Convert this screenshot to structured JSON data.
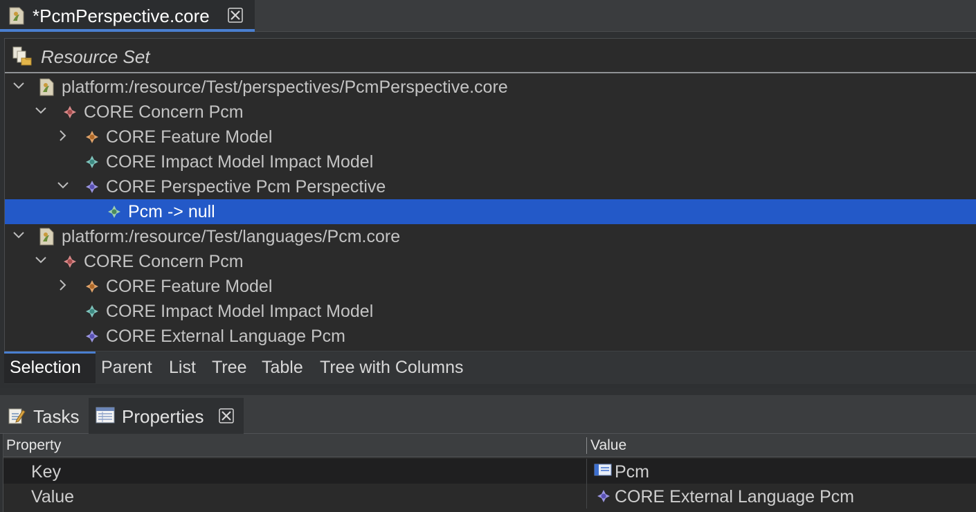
{
  "editor": {
    "tab_title": "*PcmPerspective.core",
    "tab_icon": "core-file-icon",
    "header_label": "Resource Set",
    "header_icon": "resource-set-icon",
    "tree": [
      {
        "label": "platform:/resource/Test/perspectives/PcmPerspective.core",
        "icon": "core-file-icon",
        "expanded": true
      },
      {
        "label": "CORE Concern Pcm",
        "icon": "concern-icon",
        "expanded": true
      },
      {
        "label": "CORE Feature Model",
        "icon": "feature-model-icon",
        "expanded": false
      },
      {
        "label": "CORE Impact Model Impact Model",
        "icon": "impact-model-icon"
      },
      {
        "label": "CORE Perspective Pcm Perspective",
        "icon": "perspective-icon",
        "expanded": true
      },
      {
        "label": "Pcm -> null",
        "icon": "mapping-icon",
        "selected": true
      },
      {
        "label": "platform:/resource/Test/languages/Pcm.core",
        "icon": "core-file-icon",
        "expanded": true
      },
      {
        "label": "CORE Concern Pcm",
        "icon": "concern-icon",
        "expanded": true
      },
      {
        "label": "CORE Feature Model",
        "icon": "feature-model-icon",
        "expanded": false
      },
      {
        "label": "CORE Impact Model Impact Model",
        "icon": "impact-model-icon"
      },
      {
        "label": "CORE External Language Pcm",
        "icon": "external-language-icon"
      }
    ],
    "page_tabs": [
      "Selection",
      "Parent",
      "List",
      "Tree",
      "Table",
      "Tree with Columns"
    ],
    "active_page_tab": "Selection"
  },
  "views": {
    "tabs": [
      {
        "label": "Tasks",
        "icon": "tasks-icon"
      },
      {
        "label": "Properties",
        "icon": "properties-icon",
        "active": true
      }
    ],
    "properties": {
      "col_property": "Property",
      "col_value": "Value",
      "rows": [
        {
          "name": "Key",
          "value": "Pcm",
          "value_icon": "key-value-icon"
        },
        {
          "name": "Value",
          "value": "CORE External Language Pcm",
          "value_icon": "external-language-icon"
        }
      ]
    }
  },
  "colors": {
    "selection": "#2359c8",
    "accent": "#4a7fd0",
    "background": "#2b2b2b"
  }
}
